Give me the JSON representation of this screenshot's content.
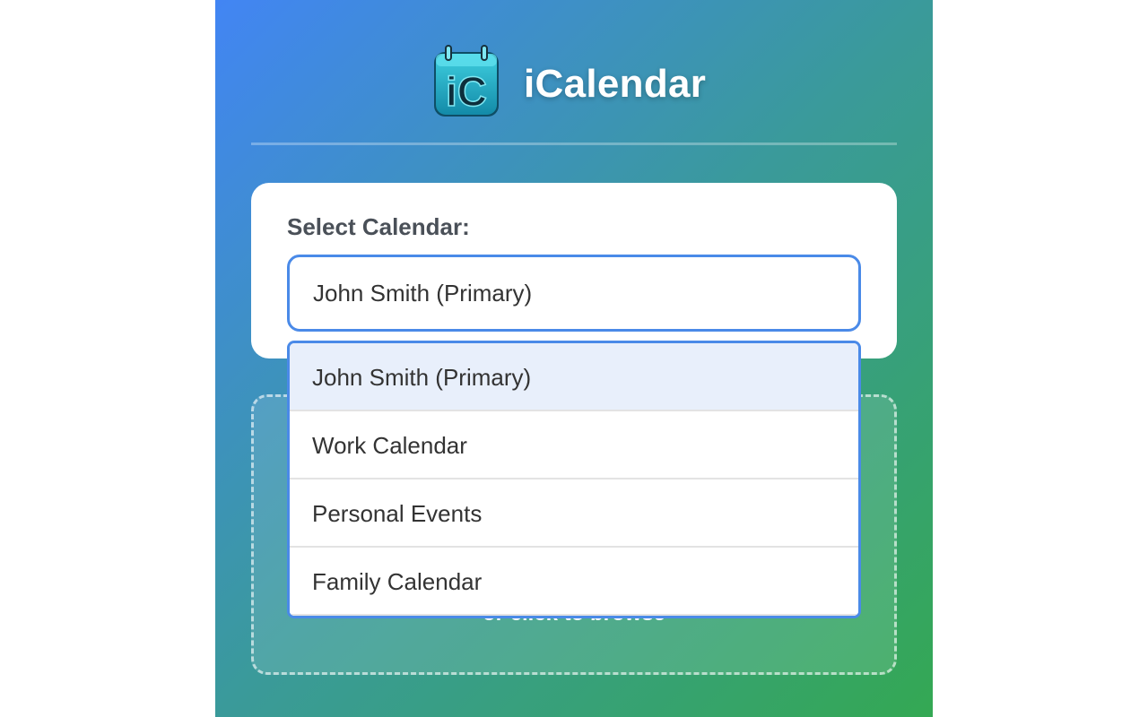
{
  "header": {
    "app_title": "iCalendar",
    "logo_text": "iC"
  },
  "calendar_selector": {
    "label": "Select Calendar:",
    "selected_value": "John Smith (Primary)",
    "options": [
      {
        "label": "John Smith (Primary)",
        "selected": true
      },
      {
        "label": "Work Calendar",
        "selected": false
      },
      {
        "label": "Personal Events",
        "selected": false
      },
      {
        "label": "Family Calendar",
        "selected": false
      }
    ]
  },
  "dropzone": {
    "hint": "or click to browse"
  },
  "colors": {
    "gradient_start": "#4285f4",
    "gradient_end": "#34a853",
    "accent": "#4a8ae8",
    "selected_option_bg": "#e8effb"
  },
  "icons": {
    "logo": "calendar-app-logo-icon"
  }
}
